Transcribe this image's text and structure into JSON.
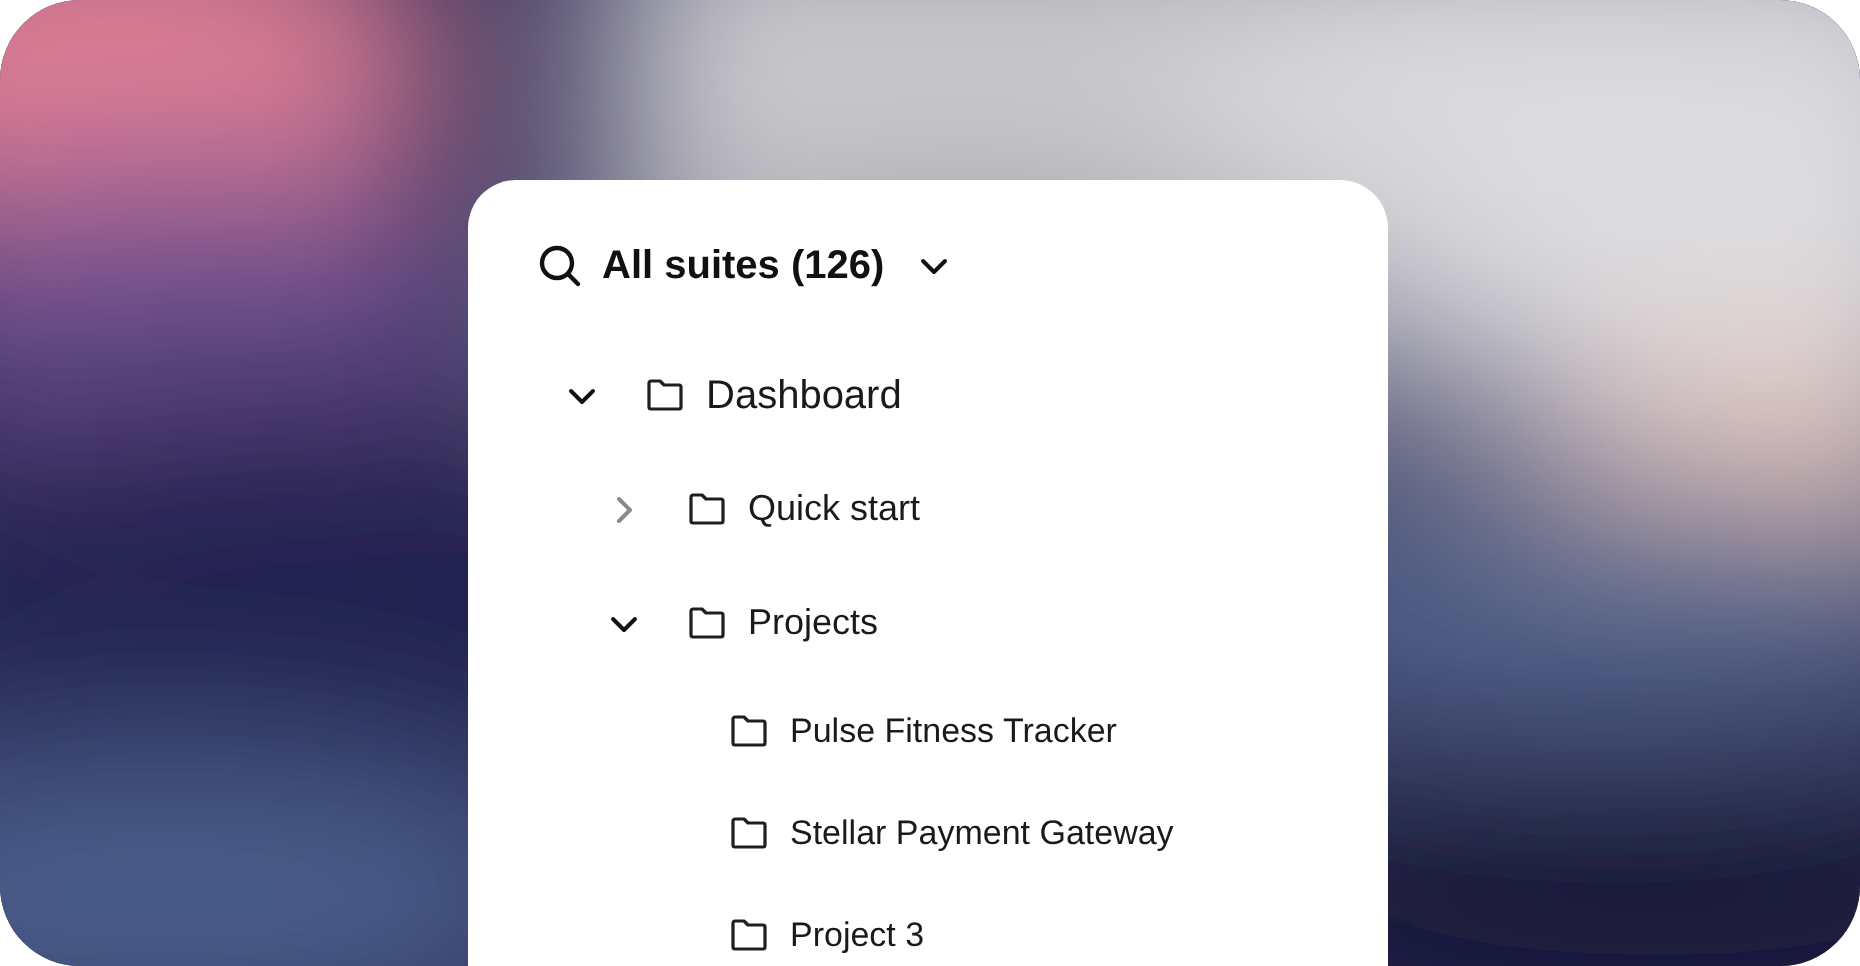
{
  "header": {
    "title": "All suites (126)"
  },
  "tree": [
    {
      "label": "Dashboard",
      "expanded": true,
      "children": [
        {
          "label": "Quick start",
          "expanded": false
        },
        {
          "label": "Projects",
          "expanded": true,
          "children": [
            {
              "label": "Pulse Fitness Tracker"
            },
            {
              "label": "Stellar Payment Gateway"
            },
            {
              "label": "Project 3"
            }
          ]
        }
      ]
    }
  ]
}
